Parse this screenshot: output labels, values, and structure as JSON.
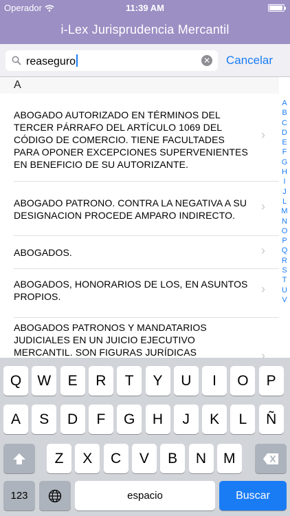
{
  "status_bar": {
    "carrier": "Operador",
    "time": "11:39 AM"
  },
  "nav": {
    "title": "i-Lex Jurisprudencia Mercantil"
  },
  "search": {
    "value": "reaseguro",
    "cancel_label": "Cancelar"
  },
  "section": {
    "header": "A"
  },
  "results": [
    {
      "lines": [
        "ABOGADO AUTORIZADO EN TÉRMINOS DEL",
        "TERCER PÁRRAFO DEL ARTÍCULO 1069 DEL",
        "CÓDIGO DE COMERCIO. TIENE FACULTADES",
        "PARA OPONER EXCEPCIONES SUPERVENIENTES",
        "EN BENEFICIO DE SU AUTORIZANTE."
      ]
    },
    {
      "lines": [
        "ABOGADO PATRONO. CONTRA LA NEGATIVA A SU",
        "DESIGNACION PROCEDE AMPARO INDIRECTO."
      ]
    },
    {
      "lines": [
        "ABOGADOS."
      ]
    },
    {
      "lines": [
        "ABOGADOS, HONORARIOS DE LOS, EN ASUNTOS",
        "PROPIOS."
      ]
    },
    {
      "lines": [
        "ABOGADOS PATRONOS Y MANDATARIOS",
        "JUDICIALES EN UN JUICIO EJECUTIVO",
        "MERCANTIL. SON FIGURAS JURÍDICAS"
      ]
    }
  ],
  "index_letters": [
    "A",
    "B",
    "C",
    "D",
    "E",
    "F",
    "G",
    "H",
    "I",
    "J",
    "L",
    "M",
    "N",
    "O",
    "P",
    "Q",
    "R",
    "S",
    "T",
    "U",
    "V"
  ],
  "keyboard": {
    "row1": [
      "Q",
      "W",
      "E",
      "R",
      "T",
      "Y",
      "U",
      "I",
      "O",
      "P"
    ],
    "row2": [
      "A",
      "S",
      "D",
      "F",
      "G",
      "H",
      "J",
      "K",
      "L",
      "Ñ"
    ],
    "row3": [
      "Z",
      "X",
      "C",
      "V",
      "B",
      "N",
      "M"
    ],
    "numbers_label": "123",
    "space_label": "espacio",
    "search_label": "Buscar"
  },
  "colors": {
    "nav_bg": "#9b8fc4",
    "accent": "#1a7cf5"
  }
}
